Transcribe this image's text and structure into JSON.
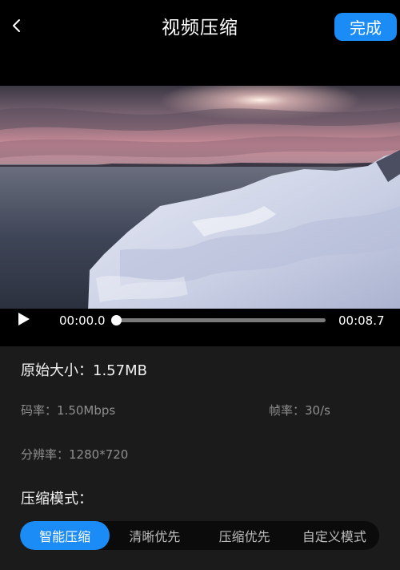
{
  "header": {
    "back_icon": "chevron-left-icon",
    "title": "视频压缩",
    "done_label": "完成"
  },
  "colors": {
    "accent": "#1b8cf5",
    "background": "#000000",
    "panel": "#1b1b1b",
    "muted_text": "#8f8f8f"
  },
  "player": {
    "play_icon": "play-icon",
    "current_time": "00:00.0",
    "total_time": "00:08.7",
    "progress": 0.0
  },
  "info": {
    "size_label": "原始大小：",
    "size_value": "1.57MB",
    "bitrate_label": "码率：",
    "bitrate_value": "1.50Mbps",
    "fps_label": "帧率：",
    "fps_value": "30/s",
    "resolution_label": "分辨率：",
    "resolution_value": "1280*720"
  },
  "compression": {
    "label": "压缩模式：",
    "modes": [
      "智能压缩",
      "清晰优先",
      "压缩优先",
      "自定义模式"
    ],
    "selected_index": 0
  }
}
